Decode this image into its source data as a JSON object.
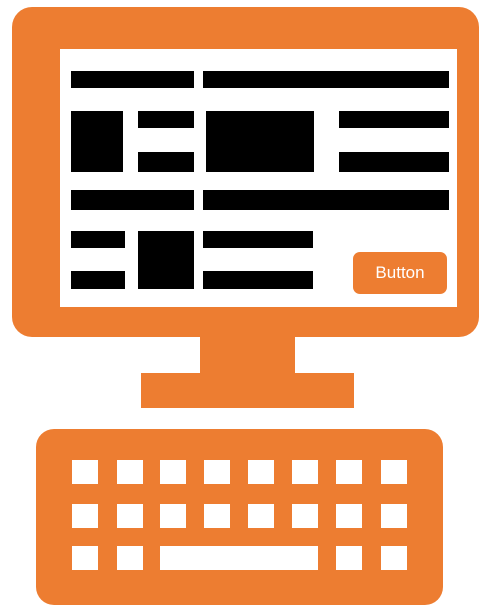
{
  "colors": {
    "accent": "#ED7D31",
    "screen_background": "#FFFFFF",
    "content_blocks": "#000000",
    "key": "#FFFFFF"
  },
  "screen": {
    "button_label": "Button"
  },
  "keyboard": {
    "rows": [
      8,
      8,
      5
    ],
    "has_spacebar": true
  },
  "icons": {
    "monitor": "monitor-icon",
    "keyboard": "keyboard-icon"
  }
}
